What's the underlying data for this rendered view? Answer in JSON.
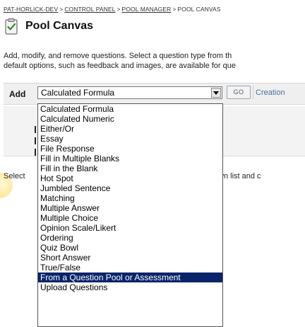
{
  "breadcrumb": {
    "items": [
      "PAT-HORLICK-DEV",
      "CONTROL PANEL",
      "POOL MANAGER",
      "POOL CANVAS"
    ],
    "separator": ">"
  },
  "page": {
    "title": "Pool Canvas",
    "icon": "clipboard-check-icon",
    "description_line1": "Add, modify, and remove questions. Select a question type from th",
    "description_line2": "default options, such as feedback and images, are available for que"
  },
  "add_question": {
    "label": "Add",
    "selected": "Calculated Formula",
    "go_label": "GO",
    "creation_label": "Creation",
    "options": [
      "Calculated Formula",
      "Calculated Numeric",
      "Either/Or",
      "Essay",
      "File Response",
      "Fill in Multiple Blanks",
      "Fill in the Blank",
      "Hot Spot",
      "Jumbled Sentence",
      "Matching",
      "Multiple Answer",
      "Multiple Choice",
      "Opinion Scale/Likert",
      "Ordering",
      "Quiz Bowl",
      "Short Answer",
      "True/False",
      "From a Question Pool or Assessment",
      "Upload Questions"
    ],
    "highlighted_option": "From a Question Pool or Assessment"
  },
  "body_text": {
    "left": "Select",
    "right": "p-down list and c"
  },
  "colors": {
    "highlight": "#0a246a",
    "panel_bg": "#f3f3f3",
    "link": "#333333"
  }
}
